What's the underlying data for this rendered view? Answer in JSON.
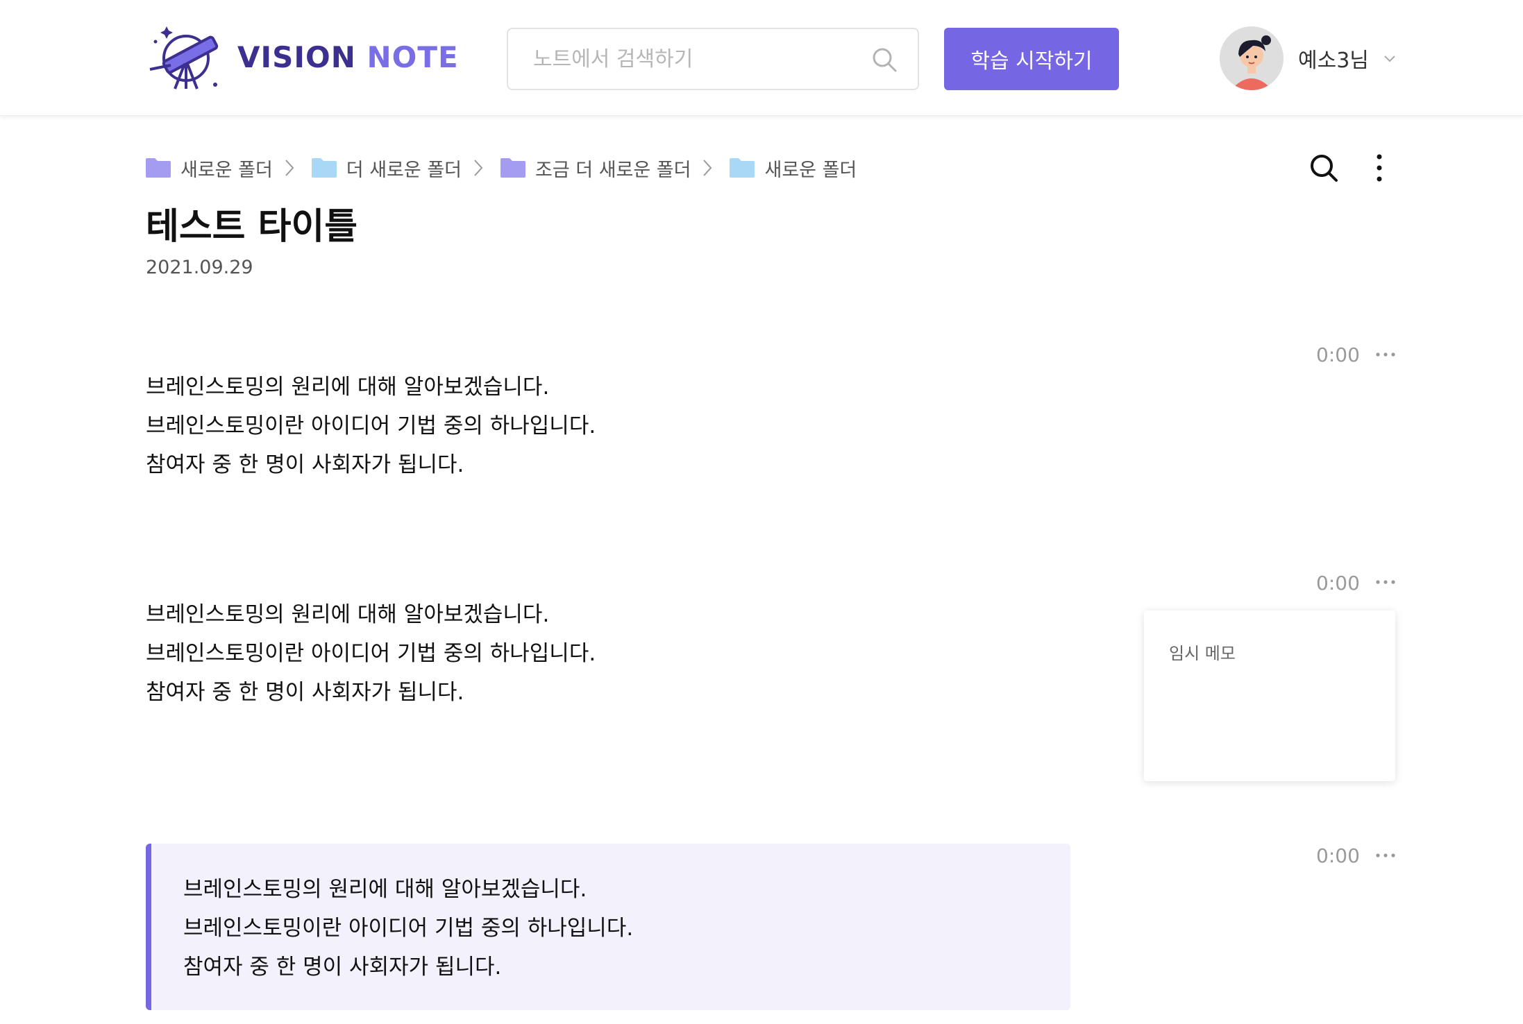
{
  "header": {
    "logo": {
      "word1": "VISION",
      "word2": "NOTE"
    },
    "search": {
      "placeholder": "노트에서 검색하기"
    },
    "start_button": "학습 시작하기",
    "user": {
      "name": "예소3님"
    }
  },
  "breadcrumb": [
    {
      "label": "새로운 폴더",
      "color": "#a49cf0"
    },
    {
      "label": "더 새로운 폴더",
      "color": "#a8d8f6"
    },
    {
      "label": "조금 더 새로운 폴더",
      "color": "#a49cf0"
    },
    {
      "label": "새로운 폴더",
      "color": "#a8d8f6"
    }
  ],
  "note": {
    "title": "테스트 타이틀",
    "date": "2021.09.29",
    "blocks": [
      {
        "time": "0:00",
        "lines": [
          "브레인스토밍의 원리에 대해 알아보겠습니다.",
          "브레인스토밍이란 아이디어 기법 중의 하나입니다.",
          "참여자 중 한 명이 사회자가 됩니다."
        ]
      },
      {
        "time": "0:00",
        "lines": [
          "브레인스토밍의 원리에 대해 알아보겠습니다.",
          "브레인스토밍이란 아이디어 기법 중의 하나입니다.",
          "참여자 중 한 명이 사회자가 됩니다."
        ],
        "memo": "임시 메모"
      },
      {
        "time": "0:00",
        "lines": [
          "브레인스토밍의 원리에 대해 알아보겠습니다.",
          "브레인스토밍이란 아이디어 기법 중의 하나입니다.",
          "참여자 중 한 명이 사회자가 됩니다."
        ],
        "highlighted": true
      }
    ]
  },
  "colors": {
    "accent": "#7566e4",
    "brand_dark": "#3b2f8f",
    "quote_bg": "#f3f1fc"
  },
  "icons": [
    "telescope-logo-icon",
    "search-icon",
    "chevron-down-icon",
    "folder-icon",
    "chevron-right-icon",
    "more-vertical-icon",
    "more-horizontal-icon"
  ]
}
